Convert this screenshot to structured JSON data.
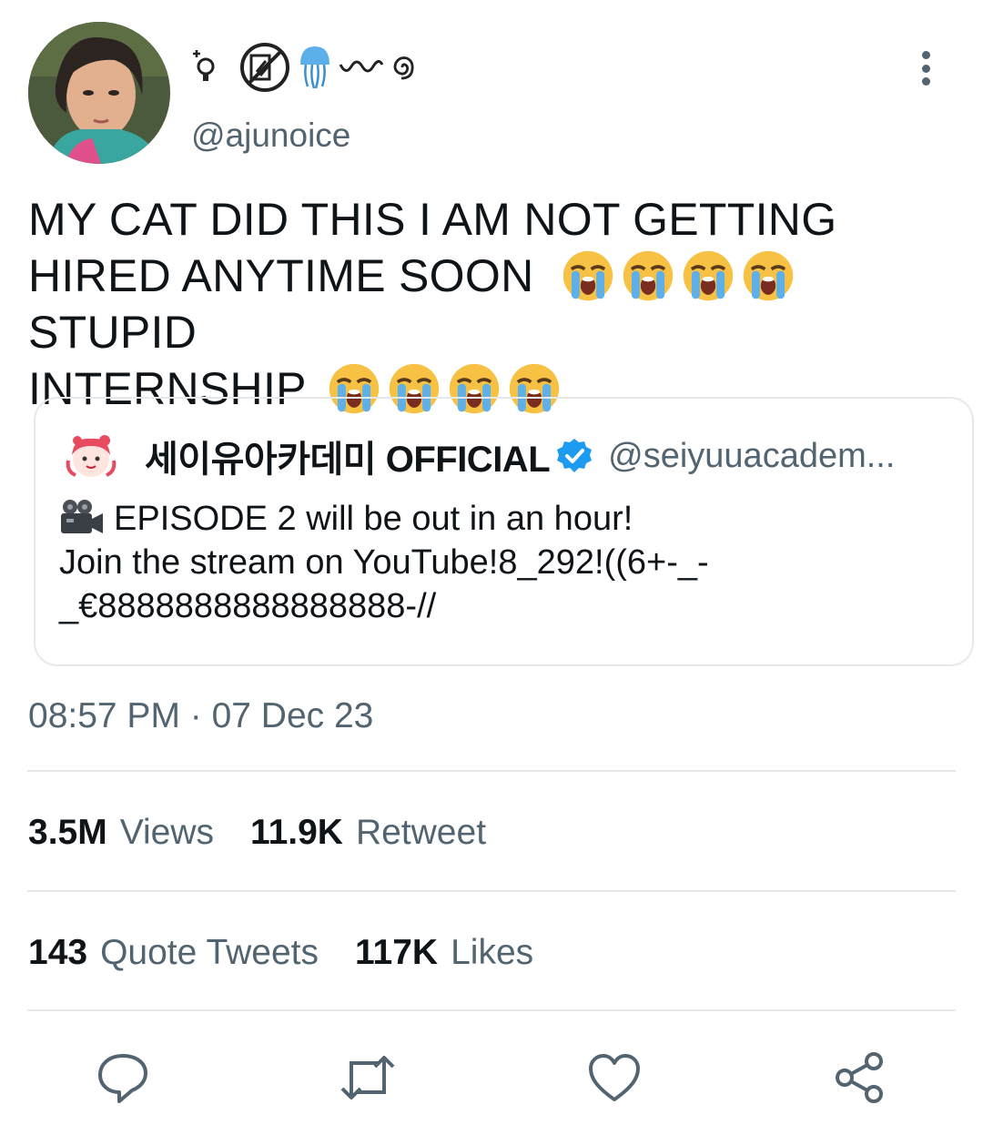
{
  "tweet": {
    "display_name_icons": [
      "lightbulb-sparkle-icon",
      "no-drawing-icon",
      "jellyfish-icon",
      "wave-icon",
      "spiral-icon"
    ],
    "handle": "@ajunoice",
    "text_line_1": "MY CAT DID THIS I AM NOT GETTING",
    "text_line_2": "HIRED ANYTIME SOON",
    "text_line_2_after": "STUPID",
    "text_line_3": "INTERNSHIP",
    "emoji": "loudly-crying-face-icon",
    "timestamp": "08:57 PM · 07 Dec 23"
  },
  "quote": {
    "name": "세이유아카데미 OFFICIAL",
    "handle": "@seiyuuacadem...",
    "line_1": "EPISODE 2 will be out in an hour!",
    "line_2": "Join the stream on YouTube!8_292!((6+-_-",
    "line_3": "_€8888888888888888-//"
  },
  "stats": {
    "views_count": "3.5M",
    "views_label": "Views",
    "retweets_count": "11.9K",
    "retweets_label": "Retweet",
    "quotes_count": "143",
    "quotes_label": "Quote Tweets",
    "likes_count": "117K",
    "likes_label": "Likes"
  },
  "actions": [
    "reply-icon",
    "retweet-icon",
    "like-icon",
    "share-icon"
  ],
  "colors": {
    "text": "#0f1419",
    "secondary": "#536471",
    "verified": "#1d9bf0",
    "divider": "#e6e9ec"
  }
}
